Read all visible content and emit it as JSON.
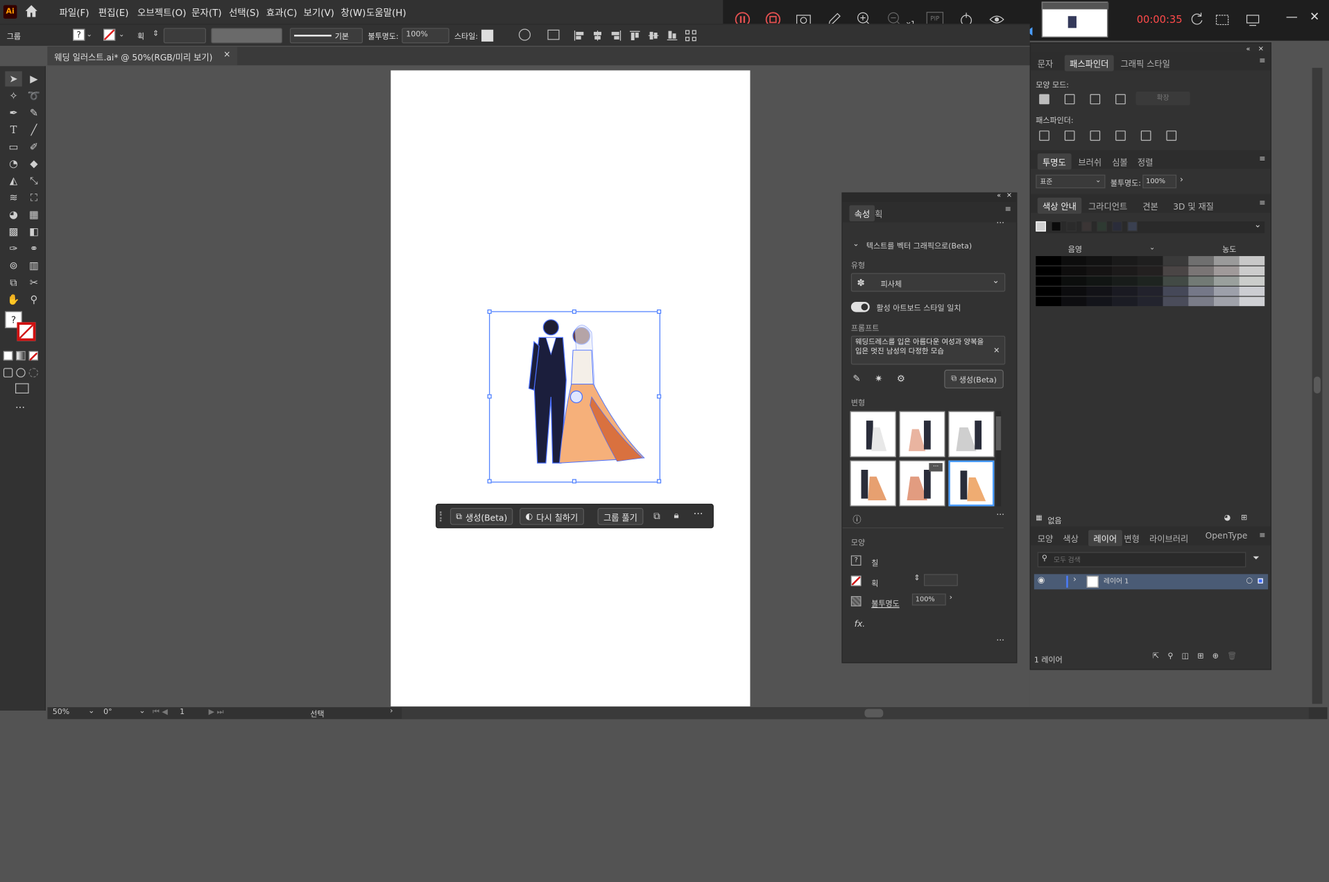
{
  "app": {
    "logo": "Ai",
    "menus": [
      "파일(F)",
      "편집(E)",
      "오브젝트(O)",
      "문자(T)",
      "선택(S)",
      "효과(C)",
      "보기(V)",
      "창(W)",
      "도움말(H)"
    ]
  },
  "control_bar": {
    "selection_type": "그룹",
    "stroke_label": "획",
    "stroke_style": "기본",
    "opacity_label": "불투명도:",
    "opacity_value": "100%",
    "style_label": "스타일:"
  },
  "document_tab": {
    "title": "웨딩 일러스트.ai* @ 50%(RGB/미리 보기)",
    "close": "×"
  },
  "recorder": {
    "zoom_label": "x1",
    "pip_label": "PIP",
    "timer": "00:00:35"
  },
  "status": {
    "zoom": "50%",
    "rotation": "0°",
    "artboard_index": "1",
    "tool_name": "선택"
  },
  "context_bar": {
    "generate": "생성(Beta)",
    "recolor": "다시 칠하기",
    "ungroup": "그룹 풀기"
  },
  "properties_panel": {
    "tabs": [
      "속성",
      "획"
    ],
    "section_title": "텍스트를 벡터 그래픽으로(Beta)",
    "type_label": "유형",
    "type_value": "피사체",
    "toggle_label": "활성 아트보드 스타일 일치",
    "prompt_label": "프롬프트",
    "prompt_text": "웨딩드레스를 입은 아름다운 여성과 양복을 입은 멋진 남성의 다정한 모습",
    "generate_button": "생성(Beta)",
    "variations_label": "변형",
    "appearance_label": "모양",
    "fill_label": "칠",
    "stroke_label": "획",
    "opacity_label": "불투명도",
    "opacity_value": "100%",
    "fx_label": "fx."
  },
  "right_panel_top": {
    "tabs": [
      "문자",
      "패스파인더",
      "그래픽 스타일"
    ],
    "shape_modes_label": "모양 모드:",
    "expand_button": "확장",
    "pathfinders_label": "패스파인더:"
  },
  "transparency_panel": {
    "tabs": [
      "투명도",
      "브러쉬",
      "심볼",
      "정렬"
    ],
    "blend_mode": "표준",
    "opacity_label": "불투명도:",
    "opacity_value": "100%"
  },
  "color_guide_panel": {
    "tabs": [
      "색상 안내",
      "그라디언트",
      "견본",
      "3D 및 재질"
    ],
    "header_left": "음영",
    "header_right": "농도",
    "base_colors": [
      "#d0d0d0",
      "#0a0a0a",
      "#2b2b2b",
      "#3b3535",
      "#2e3a32",
      "#2a2c3a",
      "#3a4050"
    ],
    "grid_colors": [
      [
        "#000000",
        "#0d0d0d",
        "#121212",
        "#1a1a1a",
        "#1f1f1f",
        "#3a3a3a",
        "#6f6f6f",
        "#9a9a9a",
        "#c8c8c8"
      ],
      [
        "#000000",
        "#0e0d0d",
        "#151313",
        "#1c1a1a",
        "#232020",
        "#4a4545",
        "#7a7575",
        "#a09a9a",
        "#cccccc"
      ],
      [
        "#000000",
        "#0c0e0d",
        "#111513",
        "#181c1a",
        "#1e2420",
        "#424a45",
        "#727a75",
        "#9aa09d",
        "#cbcdcb"
      ],
      [
        "#000000",
        "#0c0c0e",
        "#121217",
        "#1a1a22",
        "#22222c",
        "#454858",
        "#757888",
        "#9da0aa",
        "#cccdd2"
      ],
      [
        "#000000",
        "#0d0d10",
        "#13141a",
        "#1b1c24",
        "#23242e",
        "#4a4c5a",
        "#7a7c88",
        "#a0a2aa",
        "#cfd0d4"
      ]
    ],
    "footer_label": "없음"
  },
  "layers_panel": {
    "tabs": [
      "모양",
      "색상",
      "레이어",
      "변형",
      "라이브러리",
      "OpenType"
    ],
    "search_placeholder": "모두 검색",
    "layer_name": "레이어 1",
    "footer_count": "1 레이어"
  }
}
